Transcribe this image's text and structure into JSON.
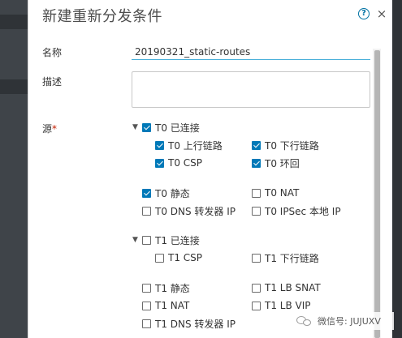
{
  "modal": {
    "title": "新建重新分发条件",
    "help_icon": "?",
    "close_icon": "×"
  },
  "form": {
    "name_label": "名称",
    "name_value": "20190321_static-routes",
    "description_label": "描述",
    "description_value": "",
    "source_label": "源",
    "required_marker": "*"
  },
  "sources": {
    "t0_connected": {
      "label": "T0 已连接",
      "checked": true,
      "expanded": true
    },
    "t0_uplink": {
      "label": "T0 上行链路",
      "checked": true
    },
    "t0_downlink": {
      "label": "T0 下行链路",
      "checked": true
    },
    "t0_csp": {
      "label": "T0 CSP",
      "checked": true
    },
    "t0_loopback": {
      "label": "T0 环回",
      "checked": true
    },
    "t0_static": {
      "label": "T0 静态",
      "checked": true
    },
    "t0_nat": {
      "label": "T0 NAT",
      "checked": false
    },
    "t0_dns": {
      "label": "T0 DNS 转发器 IP",
      "checked": false
    },
    "t0_ipsec": {
      "label": "T0 IPSec 本地 IP",
      "checked": false
    },
    "t1_connected": {
      "label": "T1 已连接",
      "checked": false,
      "expanded": true
    },
    "t1_csp": {
      "label": "T1 CSP",
      "checked": false
    },
    "t1_downlink": {
      "label": "T1 下行链路",
      "checked": false
    },
    "t1_static": {
      "label": "T1 静态",
      "checked": false
    },
    "t1_lb_snat": {
      "label": "T1 LB SNAT",
      "checked": false
    },
    "t1_nat": {
      "label": "T1 NAT",
      "checked": false
    },
    "t1_lb_vip": {
      "label": "T1 LB VIP",
      "checked": false
    },
    "t1_dns": {
      "label": "T1 DNS 转发器 IP",
      "checked": false
    }
  },
  "watermark": {
    "text": "微信号: JUJUXV"
  },
  "colors": {
    "accent": "#0079b8",
    "input_underline": "#49afd9",
    "required": "#c21d00"
  }
}
